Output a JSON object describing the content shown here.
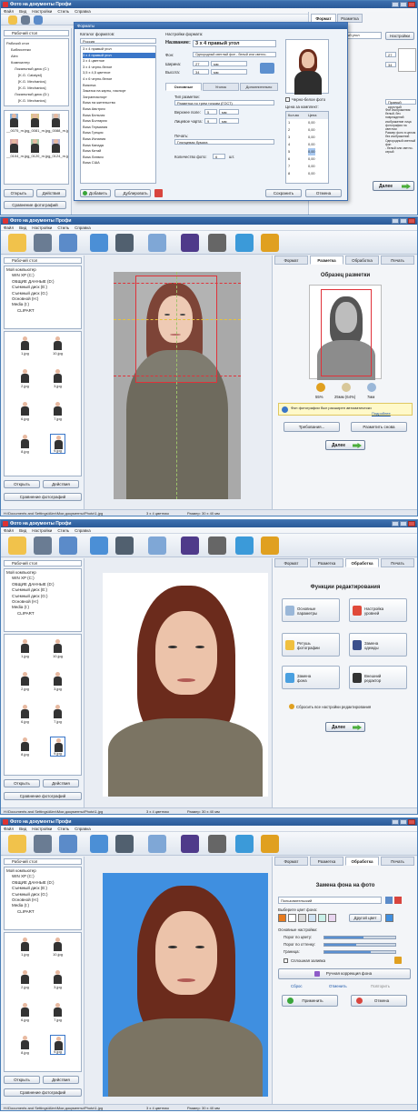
{
  "app_title": "Фото на документы Профи",
  "menu": [
    "Файл",
    "Вид",
    "Настройки",
    "Стиль",
    "Справка"
  ],
  "tabs": [
    "Формат",
    "Разметка",
    "Обработка",
    "Печать"
  ],
  "sidebar": {
    "location": "Рабочий стол",
    "tree": [
      "Мой компьютер",
      "WIN XP (C:)",
      "ОБЩИЕ ДАННЫЕ (D:)",
      "Съемный диск (E:)",
      "Съемный диск (G:)",
      "Основной (H:)",
      "Media (I:)",
      "CLIPART"
    ],
    "thumbs": [
      "1.jpg",
      "10.jpg",
      "2.jpg",
      "3.jpg",
      "6.jpg",
      "7.jpg",
      "8.jpg",
      "9.jpg"
    ],
    "open": "Открыть",
    "actions": "Действия",
    "compare": "Сравнение фотографий"
  },
  "screen1": {
    "title": "Фото на документы Профи",
    "sidebar_location": "Рабочий стол",
    "sidebar_tree": [
      "Рабочий стол",
      "Библиотеки",
      "Alex",
      "Компьютер",
      "Локальный диск (C:)",
      "[K.G. Catalyst]",
      "[K.G. Mechanics]",
      "[K.G. Mechanics]",
      "Локальный диск (D:)",
      "[K.G. Mechanics]"
    ],
    "sidebar_thumbs": [
      "__0075_m.jpg",
      "__0081_m.jpg",
      "__0088_m.jpg",
      "__0104_m.jpg",
      "__0120_m.jpg",
      "__0124_m.jpg"
    ],
    "tab_format": "Формат",
    "tab_markup": "Разметка",
    "settings_btn": "Настройки",
    "format_select": "3 x 4 правый угол",
    "dialog_title": "Форматы",
    "catalog_label": "Каталог форматов:",
    "catalog_region": "Россия",
    "formats": [
      "3 x 4 правый угол",
      "3 x 4 правый угол",
      "3 x 4 цветное",
      "3 x 4 черно-белое",
      "3,5 x 4,5 цветное",
      "4 x 6 черно-белое",
      "Визитка",
      "Закатка на карты, паспорт",
      "Загранпаспорт",
      "Виза на жительство",
      "Виза Австрия",
      "Виза Бельгия",
      "Виза Болгария",
      "Виза Германия",
      "Виза Греция",
      "Виза Испания",
      "Виза Канада",
      "Виза Китай",
      "Виза Латвия",
      "Виза США"
    ],
    "settings_label": "Настройки формата:",
    "name_label": "Название:",
    "name_value": "3 x 4 правый угол",
    "desc_label": "Фон:",
    "desc_value": "Однородный светлый фон - белый или светло-",
    "width_label": "Ширина:",
    "width_value": "27",
    "height_label": "Высота:",
    "height_value": "34",
    "unit": "мм",
    "sub_tabs": [
      "Основные",
      "Уголок",
      "Дополнительно"
    ],
    "type_label": "Тип разметки:",
    "type_value": "Разметка по трем точкам (ГОСТ)",
    "top_label": "Верхнее поле:",
    "top_value": "5",
    "left_label": "Лицевое чарта:",
    "left_value": "9",
    "print_label": "Печать:",
    "print_value": "Глянцевая бумага",
    "count_label": "Количество фото:",
    "count_value": "6",
    "count_unit": "шт.",
    "white_label": "Черно-белое фото",
    "price_label": "Цена за комплект:",
    "price_col1": "Кол-во",
    "price_col2": "Цена",
    "price_rows": [
      [
        "1",
        "0,00"
      ],
      [
        "2",
        "0,00"
      ],
      [
        "3",
        "0,00"
      ],
      [
        "4",
        "0,00"
      ],
      [
        "5",
        "0,00"
      ],
      [
        "6",
        "0,00"
      ],
      [
        "7",
        "0,00"
      ],
      [
        "8",
        "0,00"
      ]
    ],
    "add_btn": "Добавить",
    "dup_btn": "Дублировать",
    "save_btn": "Сохранить",
    "cancel_btn": "Отмена",
    "right_size_a": "27",
    "right_size_b": "34",
    "right_corner": "Правый круглый",
    "desc_lines": [
      "Фон изображения: белый, без повреждений",
      "изображение лица",
      "фотография на светлом",
      "Размер фото в целом",
      "без изображений",
      "Однородный светлый фон",
      "- белый или светло-серый"
    ],
    "next_btn": "Далее"
  },
  "screen2": {
    "title": "Фото на документы Профи",
    "active_tab": "Разметка",
    "sample_title": "Образец разметки",
    "measure1": "55%",
    "measure2": "25мм (64%)",
    "measure3": "7мм",
    "info_text": "Фон фотографии был расширен автоматически",
    "info_link": "Подробнее",
    "req_btn": "Требования...",
    "redo_btn": "Разметить снова",
    "next_btn": "Далее",
    "status_path": "H:\\Documents and Settings\\Alex\\Мои документы\\Photo\\1.jpg",
    "status_format": "3 x 4 цветная",
    "status_size": "Размер: 30 x 40 мм"
  },
  "screen3": {
    "title": "Фото на документы Профи",
    "active_tab": "Обработка",
    "heading": "Функции редактирования",
    "buttons": [
      [
        "Основные",
        "параметры"
      ],
      [
        "Настройка",
        "уровней"
      ],
      [
        "Ретушь",
        "фотографии"
      ],
      [
        "Замена",
        "одежды"
      ],
      [
        "Замена",
        "фона"
      ],
      [
        "Внешний",
        "редактор"
      ]
    ],
    "reset": "Сбросить все настройки редактирования",
    "next_btn": "Далее",
    "status_path": "H:\\Documents and Settings\\Alex\\Мои документы\\Photo\\1.jpg",
    "status_format": "3 x 4 цветная",
    "status_size": "Размер: 30 x 40 мм"
  },
  "screen4": {
    "title": "Фото на документы Профи",
    "active_tab": "Обработка",
    "heading": "Замена фона на фото",
    "bg_select": "Пользовательский",
    "choose_color": "Выберите цвет фона:",
    "other_color": "Другой цвет",
    "basic_settings": "Основные настройки:",
    "s1": "Порог по цвету:",
    "s2": "Порог по оттенку:",
    "s3": "Граница:",
    "fill": "Сплошная заливка",
    "manual": "Ручная коррекция фона",
    "reset": "Сброс",
    "undo": "Отменить",
    "redo": "Повторить",
    "apply": "Применить",
    "cancel": "Отмена",
    "swatches": [
      "#e87b1e",
      "#ffffff",
      "#d9d9d9",
      "#cfe2f3",
      "#c9f0e8",
      "#e9d5ef"
    ],
    "status_path": "H:\\Documents and Settings\\Alex\\Мои документы\\Photo\\1.jpg",
    "status_format": "3 x 4 цветная",
    "status_size": "Размер: 30 x 40 мм"
  }
}
